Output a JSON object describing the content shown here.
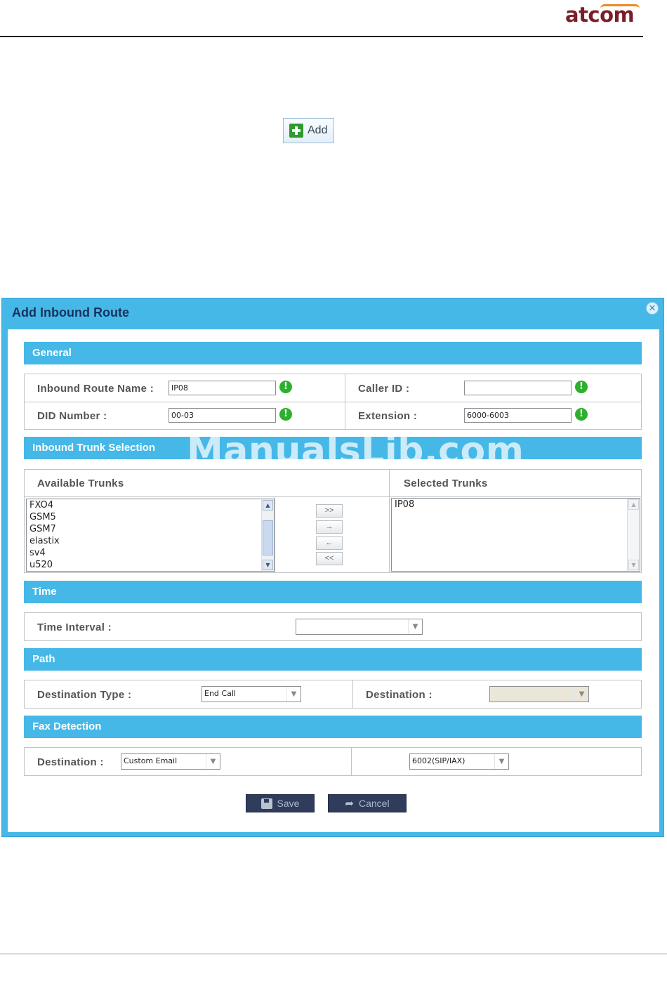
{
  "brand": {
    "logo_text": "atcom",
    "brand_color": "#7a1e2b",
    "swoosh_color": "#f08a1c"
  },
  "toolbar": {
    "add_label": "Add"
  },
  "dialog": {
    "title": "Add Inbound Route",
    "accent_color": "#45b8e8",
    "general": {
      "section_title": "General",
      "route_name_label": "Inbound Route Name :",
      "route_name_value": "IP08",
      "caller_id_label": "Caller ID :",
      "caller_id_value": "",
      "did_label": "DID Number :",
      "did_value": "00-03",
      "extension_label": "Extension :",
      "extension_value": "6000-6003"
    },
    "trunks": {
      "section_title": "Inbound Trunk Selection",
      "available_label": "Available Trunks",
      "selected_label": "Selected Trunks",
      "available": [
        "FXO4",
        "GSM5",
        "GSM7",
        "elastix",
        "sv4",
        "u520"
      ],
      "selected": [
        "IP08"
      ],
      "move_all_right": ">>",
      "move_right": "→",
      "move_left": "←",
      "move_all_left": "<<"
    },
    "time": {
      "section_title": "Time",
      "interval_label": "Time Interval :",
      "interval_value": ""
    },
    "path": {
      "section_title": "Path",
      "dest_type_label": "Destination Type :",
      "dest_type_value": "End Call",
      "destination_label": "Destination :",
      "destination_value": ""
    },
    "fax": {
      "section_title": "Fax Detection",
      "destination_label": "Destination :",
      "destination_value": "Custom Email",
      "target_value": "6002(SIP/IAX)"
    },
    "save_label": "Save",
    "cancel_label": "Cancel"
  },
  "watermark": "ManualsLib.com"
}
